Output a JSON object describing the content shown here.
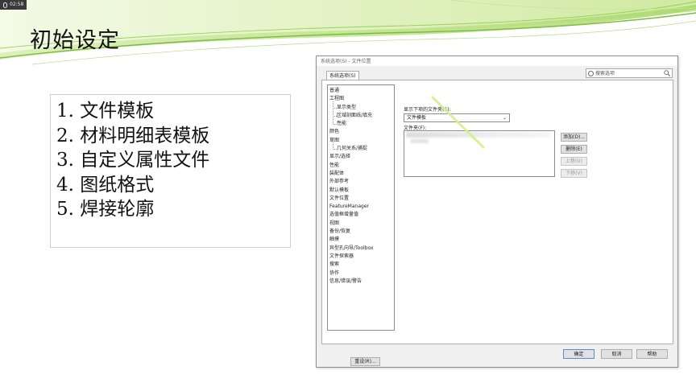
{
  "recorder": {
    "time": "02:58"
  },
  "slide": {
    "title": "初始设定",
    "items": [
      "1. 文件模板",
      "2. 材料明细表模板",
      "3. 自定义属性文件",
      "4. 图纸格式",
      "5. 焊接轮廓"
    ]
  },
  "dialog": {
    "title": "系统选项(S) - 文件位置",
    "tab": "系统选项(S)",
    "search_placeholder": "搜索选项",
    "tree": [
      {
        "label": "普通",
        "sub": false
      },
      {
        "label": "工程图",
        "sub": false
      },
      {
        "label": "显示类型",
        "sub": true
      },
      {
        "label": "区域剖面线/填充",
        "sub": true
      },
      {
        "label": "性能",
        "sub": true
      },
      {
        "label": "颜色",
        "sub": false
      },
      {
        "label": "草图",
        "sub": false
      },
      {
        "label": "几何关系/捕捉",
        "sub": true
      },
      {
        "label": "显示/选择",
        "sub": false
      },
      {
        "label": "性能",
        "sub": false
      },
      {
        "label": "装配体",
        "sub": false
      },
      {
        "label": "外部参考",
        "sub": false
      },
      {
        "label": "默认模板",
        "sub": false
      },
      {
        "label": "文件位置",
        "sub": false
      },
      {
        "label": "FeatureManager",
        "sub": false
      },
      {
        "label": "选值框增量值",
        "sub": false
      },
      {
        "label": "视图",
        "sub": false
      },
      {
        "label": "备份/恢复",
        "sub": false
      },
      {
        "label": "触摸",
        "sub": false
      },
      {
        "label": "异型孔向导/Toolbox",
        "sub": false
      },
      {
        "label": "文件探索器",
        "sub": false
      },
      {
        "label": "搜索",
        "sub": false
      },
      {
        "label": "协作",
        "sub": false
      },
      {
        "label": "信息/错误/警告",
        "sub": false
      }
    ],
    "reset_label": "重设(R)...",
    "show_folders_label": "显示下项的文件夹(S):",
    "show_folders_value": "文件模板",
    "folders_label": "文件夹(F):",
    "add_label": "添加(D)...",
    "delete_label": "删除(E)",
    "move_up_label": "上移(U)",
    "move_down_label": "下移(V)",
    "ok_label": "确定",
    "cancel_label": "取消",
    "help_label": "帮助"
  },
  "colors": {
    "swoosh_light": "#e4f3c4",
    "swoosh_mid": "#a9d56a",
    "swoosh_dark": "#6fae2f",
    "pointer": "#d7ef8a"
  }
}
